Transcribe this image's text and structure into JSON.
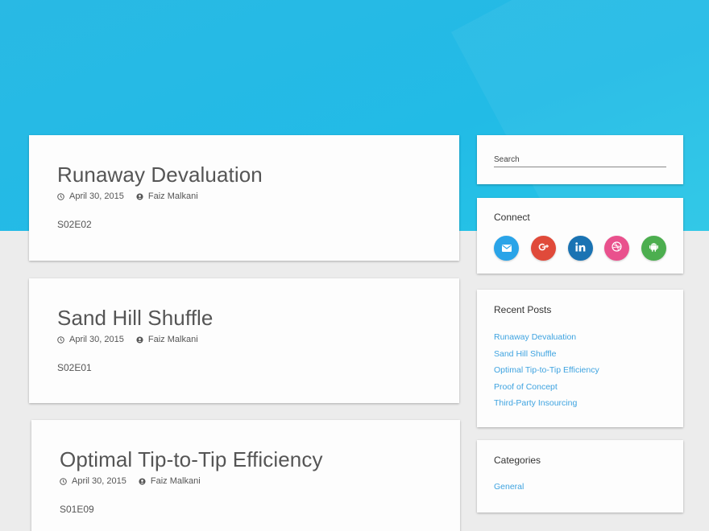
{
  "posts": [
    {
      "title": "Runaway Devaluation",
      "date": "April 30, 2015",
      "author": "Faiz Malkani",
      "excerpt": "S02E02"
    },
    {
      "title": "Sand Hill Shuffle",
      "date": "April 30, 2015",
      "author": "Faiz Malkani",
      "excerpt": "S02E01"
    },
    {
      "title": "Optimal Tip-to-Tip Efficiency",
      "date": "April 30, 2015",
      "author": "Faiz Malkani",
      "excerpt": "S01E09"
    }
  ],
  "sidebar": {
    "search": {
      "placeholder": "Search"
    },
    "connect": {
      "title": "Connect",
      "icons": [
        {
          "name": "email-icon",
          "color": "#2aa4e8"
        },
        {
          "name": "google-plus-icon",
          "color": "#e04a3a"
        },
        {
          "name": "linkedin-icon",
          "color": "#1a73b3"
        },
        {
          "name": "dribbble-icon",
          "color": "#e9518d"
        },
        {
          "name": "android-icon",
          "color": "#4cae4f"
        }
      ]
    },
    "recent_posts": {
      "title": "Recent Posts",
      "items": [
        "Runaway Devaluation",
        "Sand Hill Shuffle",
        "Optimal Tip-to-Tip Efficiency",
        "Proof of Concept",
        "Third-Party Insourcing"
      ]
    },
    "categories": {
      "title": "Categories",
      "items": [
        "General"
      ]
    }
  },
  "colors": {
    "hero": "#29b9e4",
    "link": "#3ea3e0"
  }
}
